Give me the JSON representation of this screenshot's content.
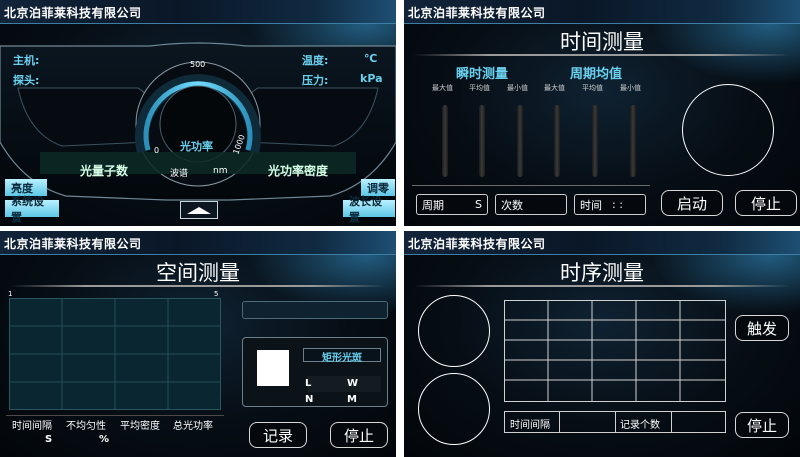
{
  "company": "北京泊菲莱科技有限公司",
  "colors": {
    "accent_cyan": "#6ad0ee",
    "header_blue": "#1e4f73",
    "background": "#060d14"
  },
  "dashboard": {
    "host_label": "主机:",
    "probe_label": "探头:",
    "temp_label": "温度:",
    "temp_unit": "℃",
    "pressure_label": "压力:",
    "pressure_unit": "kPa",
    "gauge": {
      "max_label": "500",
      "min_label": "0",
      "right_label": "1000",
      "title": "光功率"
    },
    "wavelength_label": "波谱",
    "wavelength_unit": "nm",
    "photon_count_label": "光量子数",
    "power_density_label": "光功率密度",
    "brightness_button": "亮度",
    "system_settings_button": "系统设置",
    "zero_button": "调零",
    "wavelength_settings_button": "波长设置"
  },
  "time_measure": {
    "title": "时间测量",
    "instant_label": "瞬时测量",
    "period_avg_label": "周期均值",
    "columns": [
      "最大值",
      "平均值",
      "最小值",
      "最大值",
      "平均值",
      "最小值"
    ],
    "period_label": "周期",
    "period_unit": "S",
    "count_label": "次数",
    "time_label": "时间",
    "time_value": ":   :",
    "start_button": "启动",
    "stop_button": "停止"
  },
  "space_measure": {
    "title": "空间测量",
    "grid_left_label": "1",
    "grid_right_label": "5",
    "rect_spot_label": "矩形光斑",
    "L": "L",
    "W": "W",
    "N": "N",
    "M": "M",
    "footer_labels": [
      "时间间隔",
      "不均匀性",
      "平均密度",
      "总光功率"
    ],
    "footer_units": [
      "S",
      "%"
    ],
    "record_button": "记录",
    "stop_button": "停止"
  },
  "sequence_measure": {
    "title": "时序测量",
    "trigger_button": "触发",
    "stop_button": "停止",
    "interval_label": "时间间隔",
    "record_count_label": "记录个数"
  }
}
